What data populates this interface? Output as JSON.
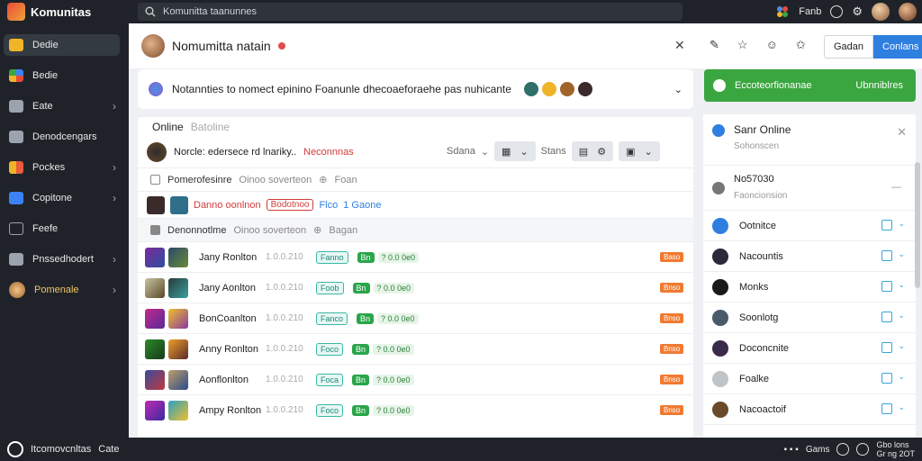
{
  "topbar": {
    "app_title": "Komunitas",
    "search_text": "Komunitta taanunnes",
    "user_label": "Fanb"
  },
  "sidebar": {
    "items": [
      {
        "label": "Dedie",
        "icon": "folder-icon",
        "color": "#f0b429",
        "chev": false,
        "active": true
      },
      {
        "label": "Bedie",
        "icon": "apps-icon",
        "color": "#3b82f6",
        "chev": false
      },
      {
        "label": "Eate",
        "icon": "briefcase-icon",
        "color": "#9ca3af",
        "chev": true
      },
      {
        "label": "Denodcengars",
        "icon": "lock-icon",
        "color": "#9ca3af",
        "chev": false
      },
      {
        "label": "Pockes",
        "icon": "grid-icon",
        "color": "#e85d3a",
        "chev": true
      },
      {
        "label": "Copitone",
        "icon": "bag-icon",
        "color": "#3b82f6",
        "chev": true
      },
      {
        "label": "Feefe",
        "icon": "calendar-icon",
        "color": "#9ca3af",
        "chev": false
      },
      {
        "label": "Pnssedhodert",
        "icon": "home-icon",
        "color": "#9ca3af",
        "chev": true
      },
      {
        "label": "Pomenale",
        "icon": "avatar-icon",
        "color": "#f0b429",
        "chev": true
      }
    ]
  },
  "header": {
    "title": "Nomumitta natain",
    "btn_secondary": "Gadan",
    "btn_primary": "Conlans"
  },
  "banner": {
    "text": "Notannties to nomect epinino Foanunle dhecoaeforaehe pas nuhicante"
  },
  "green_card": {
    "left": "Eccoteorfionanae",
    "right": "Ubnniblres"
  },
  "panel": {
    "online_label": "Online",
    "online_muted": "Batoline",
    "filter_text": "Norcle: edersece rd lnariky..",
    "filter_red": "Neconnnas",
    "filter_sort": "Sdana",
    "filter_store": "Stans",
    "section1_text": "Pomerofesinre",
    "section1_muted": "Oinoo soverteon",
    "section1_muted2": "Foan",
    "tag_red": "Danno oonlnon",
    "tag_outline": "Bodotnoo",
    "tag_blue": "Flco",
    "tag_blue2": "1 Gaone",
    "section2_text": "Denonnotlme",
    "section2_muted": "Oinoo soverteon",
    "section2_muted2": "Bagan",
    "rows": [
      {
        "name": "Jany Ronlton",
        "num": "1.0.0.210",
        "teal": "Fanno",
        "green": "Bn",
        "gtext": "? 0.0 0e0",
        "orange": "Baso"
      },
      {
        "name": "Jany Aonlton",
        "num": "1.0.0.210",
        "teal": "Foob",
        "green": "Bn",
        "gtext": "? 0.0 0e0",
        "orange": "Bnso"
      },
      {
        "name": "BonCoanlton",
        "num": "1.0.0.210",
        "teal": "Fanco",
        "green": "Bn",
        "gtext": "? 0.0 0e0",
        "orange": "Bnso"
      },
      {
        "name": "Anny Ronlton",
        "num": "1.0.0.210",
        "teal": "Foco",
        "green": "Bn",
        "gtext": "? 0.0 0e0",
        "orange": "Bnso"
      },
      {
        "name": "Aonflonlton",
        "num": "1.0.0.210",
        "teal": "Foca",
        "green": "Bn",
        "gtext": "? 0.0 0e0",
        "orange": "Bnso"
      },
      {
        "name": "Ampy Ronlton",
        "num": "1.0.0.210",
        "teal": "Foco",
        "green": "Bn",
        "gtext": "? 0.0 0e0",
        "orange": "Bnso"
      }
    ]
  },
  "right_panel": {
    "top_title": "Sanr Online",
    "top_sub": "Sohonscen",
    "mid_title": "No57030",
    "mid_sub": "Faoncionsion",
    "rows": [
      {
        "label": "Ootnitce"
      },
      {
        "label": "Nacountis"
      },
      {
        "label": "Monks"
      },
      {
        "label": "Soonlotg"
      },
      {
        "label": "Doconcnite"
      },
      {
        "label": "Foalke"
      },
      {
        "label": "Nacoactoif"
      }
    ]
  },
  "bottombar": {
    "left_title": "Itcomovcnltas",
    "left_sub": "Cate",
    "right_label": "Gams",
    "right_line1": "Gbo lons",
    "right_line2": "Gr ng 2OT"
  }
}
